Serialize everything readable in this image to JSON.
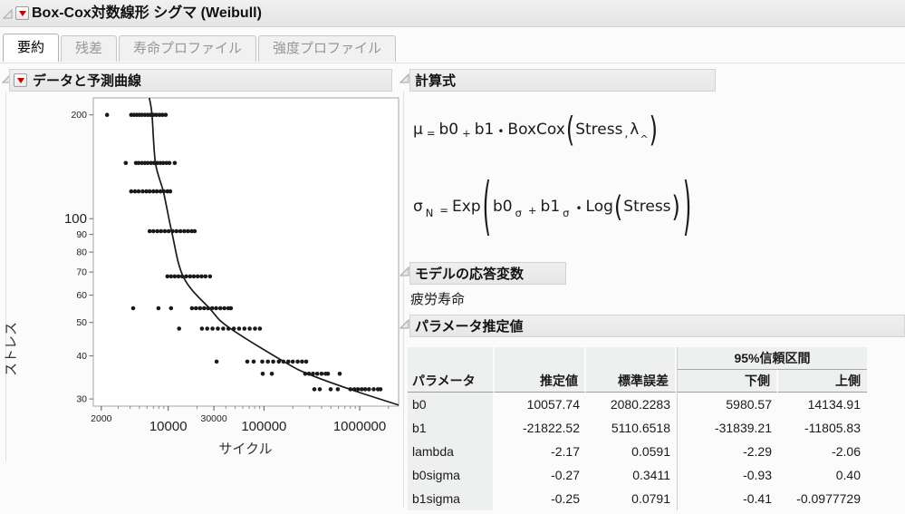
{
  "window": {
    "title": "Box-Cox対数線形 シグマ (Weibull)"
  },
  "tabs": [
    {
      "label": "要約",
      "active": true
    },
    {
      "label": "残差",
      "active": false
    },
    {
      "label": "寿命プロファイル",
      "active": false
    },
    {
      "label": "強度プロファイル",
      "active": false
    }
  ],
  "sections": {
    "data_plot": {
      "title": "データと予測曲線"
    },
    "formula": {
      "title": "計算式"
    },
    "response": {
      "title": "モデルの応答変数",
      "value": "疲労寿命"
    },
    "estimates": {
      "title": "パラメータ推定値"
    }
  },
  "formulas": {
    "mu": {
      "lhs": "μ",
      "eq": "=",
      "b0": "b0",
      "plus": "+",
      "b1": "b1",
      "dot": "•",
      "func": "BoxCox",
      "open": "(",
      "arg": "Stress",
      "comma": ",",
      "lambda": "λ",
      "hat": "^",
      "close": ")"
    },
    "sigma": {
      "lhs": "σ",
      "lhs_sub": "N",
      "eq": "=",
      "func": "Exp",
      "open": "(",
      "b0": "b0",
      "b0_sub": "σ",
      "plus": "+",
      "b1": "b1",
      "b1_sub": "σ",
      "dot": "•",
      "func2": "Log",
      "open2": "(",
      "arg": "Stress",
      "close2": ")",
      "close": ")"
    }
  },
  "estimates_table": {
    "ci_span_header": "95%信頼区間",
    "columns": [
      "パラメータ",
      "推定値",
      "標準誤差",
      "下側",
      "上側"
    ],
    "rows": [
      [
        "b0",
        "10057.74",
        "2080.2283",
        "5980.57",
        "14134.91"
      ],
      [
        "b1",
        "-21822.52",
        "5110.6518",
        "-31839.21",
        "-11805.83"
      ],
      [
        "lambda",
        "-2.17",
        "0.0591",
        "-2.29",
        "-2.06"
      ],
      [
        "b0sigma",
        "-0.27",
        "0.3411",
        "-0.93",
        "0.40"
      ],
      [
        "b1sigma",
        "-0.25",
        "0.0791",
        "-0.41",
        "-0.0977729"
      ]
    ]
  },
  "chart_data": {
    "type": "scatter",
    "title": "データと予測曲線",
    "xlabel": "サイクル",
    "ylabel": "ストレス",
    "x_scale": "log",
    "y_scale": "log",
    "xlim": [
      1650,
      2550000
    ],
    "ylim": [
      28.6,
      224
    ],
    "grid": false,
    "x_ticks": [
      {
        "v": 2000,
        "label": "2000",
        "big": false
      },
      {
        "v": 10000,
        "label": "10000",
        "big": true
      },
      {
        "v": 30000,
        "label": "30000",
        "big": false
      },
      {
        "v": 100000,
        "label": "100000",
        "big": true
      },
      {
        "v": 1000000,
        "label": "1000000",
        "big": true
      }
    ],
    "x_minor_ticks": [
      3000,
      4000,
      5000,
      6000,
      7000,
      8000,
      9000,
      20000,
      40000,
      50000,
      60000,
      70000,
      80000,
      90000,
      200000,
      300000,
      400000,
      500000,
      600000,
      700000,
      800000,
      900000,
      2000000
    ],
    "y_ticks": [
      {
        "v": 200,
        "label": "200",
        "big": false
      },
      {
        "v": 100,
        "label": "100",
        "big": true
      },
      {
        "v": 90,
        "label": "90",
        "big": false
      },
      {
        "v": 80,
        "label": "80",
        "big": false
      },
      {
        "v": 70,
        "label": "70",
        "big": false
      },
      {
        "v": 60,
        "label": "60",
        "big": false
      },
      {
        "v": 50,
        "label": "50",
        "big": false
      },
      {
        "v": 40,
        "label": "40",
        "big": false
      },
      {
        "v": 30,
        "label": "30",
        "big": false
      }
    ],
    "series": [
      {
        "stress": 200,
        "cycles": [
          2300,
          4100,
          4400,
          4700,
          5000,
          5300,
          5700,
          6100,
          6500,
          7000,
          7500,
          8100,
          8700,
          9400
        ]
      },
      {
        "stress": 145,
        "cycles": [
          3600,
          4600,
          4900,
          5300,
          5700,
          6100,
          6600,
          7100,
          7700,
          8300,
          8900,
          9600,
          10300,
          11700
        ]
      },
      {
        "stress": 120,
        "cycles": [
          4100,
          4500,
          4900,
          5400,
          5900,
          6400,
          7000,
          7600,
          8300,
          9000,
          9800,
          10500
        ]
      },
      {
        "stress": 92,
        "cycles": [
          6400,
          7000,
          7700,
          8400,
          9200,
          10100,
          11100,
          12200,
          13400,
          14700,
          16100,
          17600,
          18900
        ]
      },
      {
        "stress": 68,
        "cycles": [
          9800,
          10700,
          11700,
          12800,
          14000,
          15400,
          16900,
          18500,
          20300,
          22300,
          24500,
          27300
        ]
      },
      {
        "stress": 55,
        "cycles": [
          4300,
          7900,
          10700,
          17700,
          19500,
          21500,
          23700,
          26100,
          28800,
          31700,
          35000,
          38600,
          42500,
          45200
        ]
      },
      {
        "stress": 48,
        "cycles": [
          13000,
          22500,
          25500,
          29000,
          33000,
          37500,
          42600,
          48400,
          55000,
          62500,
          71000,
          80700,
          90800
        ]
      },
      {
        "stress": 38.5,
        "cycles": [
          32000,
          67000,
          78000,
          96000,
          110000,
          125000,
          143000,
          160000,
          180000,
          200000,
          225000,
          250000,
          276000
        ]
      },
      {
        "stress": 35.5,
        "cycles": [
          97000,
          121000,
          270000,
          295000,
          325000,
          360000,
          400000,
          440000,
          466000,
          618000
        ]
      },
      {
        "stress": 32,
        "cycles": [
          336000,
          383000,
          497000,
          591000,
          800000,
          880000,
          960000,
          1050000,
          1140000,
          1250000,
          1400000,
          1550000,
          1650000
        ]
      }
    ],
    "curve": [
      [
        6350,
        224
      ],
      [
        6770,
        200
      ],
      [
        7360,
        145
      ],
      [
        8950,
        119
      ],
      [
        10900,
        91.5
      ],
      [
        14500,
        67.5
      ],
      [
        27400,
        54.7
      ],
      [
        43300,
        48.3
      ],
      [
        167000,
        38.3
      ],
      [
        301000,
        35.3
      ],
      [
        822000,
        31.9
      ],
      [
        2550000,
        28.8
      ]
    ]
  },
  "colors": {
    "accent_red": "#c40000",
    "header_bg": "#e9e9e9",
    "point": "#1a1a1a",
    "curve": "#1a1a1a"
  }
}
